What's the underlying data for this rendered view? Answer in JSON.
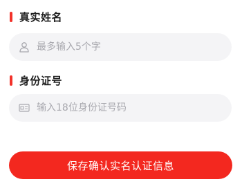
{
  "name_section": {
    "label": "真实姓名",
    "placeholder": "最多输入5个字",
    "value": "",
    "icon": "user-icon"
  },
  "id_section": {
    "label": "身份证号",
    "placeholder": "输入18位身份证号码",
    "value": "",
    "icon": "id-card-icon"
  },
  "submit": {
    "label": "保存确认实名认证信息"
  },
  "colors": {
    "accent": "#f2322a",
    "button": "#f3281f",
    "field_bg": "#f4f4f6",
    "placeholder": "#a8a8ae"
  }
}
